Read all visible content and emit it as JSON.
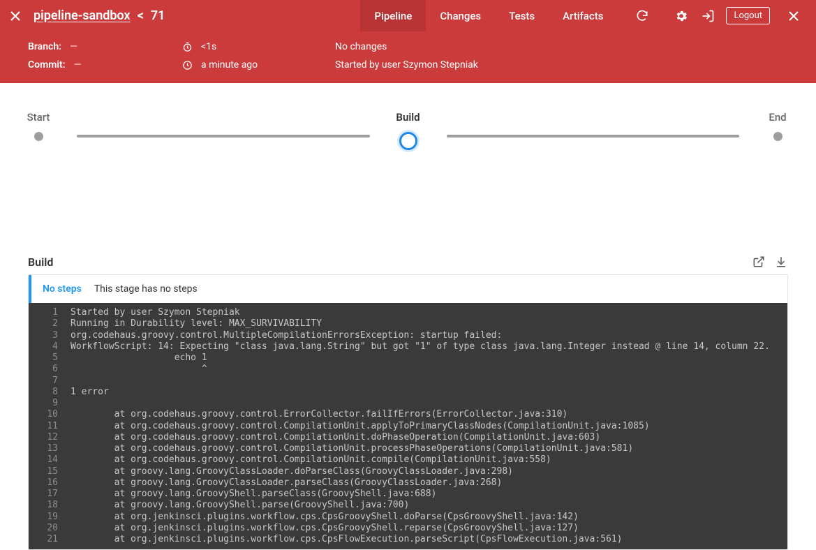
{
  "header": {
    "pipeline_name": "pipeline-sandbox",
    "separator": "<",
    "run_number": "71",
    "tabs": [
      {
        "label": "Pipeline",
        "active": true
      },
      {
        "label": "Changes",
        "active": false
      },
      {
        "label": "Tests",
        "active": false
      },
      {
        "label": "Artifacts",
        "active": false
      }
    ],
    "logout_label": "Logout"
  },
  "info": {
    "branch_label": "Branch:",
    "branch_value": "—",
    "commit_label": "Commit:",
    "commit_value": "—",
    "duration": "<1s",
    "when": "a minute ago",
    "changes": "No changes",
    "started_by": "Started by user Szymon Stepniak"
  },
  "stages": {
    "start": "Start",
    "build": "Build",
    "end": "End"
  },
  "section": {
    "title": "Build",
    "no_steps_title": "No steps",
    "no_steps_msg": "This stage has no steps"
  },
  "console_lines": [
    "Started by user Szymon Stepniak",
    "Running in Durability level: MAX_SURVIVABILITY",
    "org.codehaus.groovy.control.MultipleCompilationErrorsException: startup failed:",
    "WorkflowScript: 14: Expecting \"class java.lang.String\" but got \"1\" of type class java.lang.Integer instead @ line 14, column 22.",
    "                   echo 1",
    "                        ^",
    "",
    "1 error",
    "",
    "\tat org.codehaus.groovy.control.ErrorCollector.failIfErrors(ErrorCollector.java:310)",
    "\tat org.codehaus.groovy.control.CompilationUnit.applyToPrimaryClassNodes(CompilationUnit.java:1085)",
    "\tat org.codehaus.groovy.control.CompilationUnit.doPhaseOperation(CompilationUnit.java:603)",
    "\tat org.codehaus.groovy.control.CompilationUnit.processPhaseOperations(CompilationUnit.java:581)",
    "\tat org.codehaus.groovy.control.CompilationUnit.compile(CompilationUnit.java:558)",
    "\tat groovy.lang.GroovyClassLoader.doParseClass(GroovyClassLoader.java:298)",
    "\tat groovy.lang.GroovyClassLoader.parseClass(GroovyClassLoader.java:268)",
    "\tat groovy.lang.GroovyShell.parseClass(GroovyShell.java:688)",
    "\tat groovy.lang.GroovyShell.parse(GroovyShell.java:700)",
    "\tat org.jenkinsci.plugins.workflow.cps.CpsGroovyShell.doParse(CpsGroovyShell.java:142)",
    "\tat org.jenkinsci.plugins.workflow.cps.CpsGroovyShell.reparse(CpsGroovyShell.java:127)",
    "\tat org.jenkinsci.plugins.workflow.cps.CpsFlowExecution.parseScript(CpsFlowExecution.java:561)"
  ]
}
